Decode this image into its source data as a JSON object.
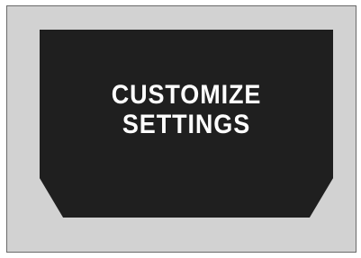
{
  "display": {
    "line1": "CUSTOMIZE",
    "line2": "SETTINGS"
  }
}
